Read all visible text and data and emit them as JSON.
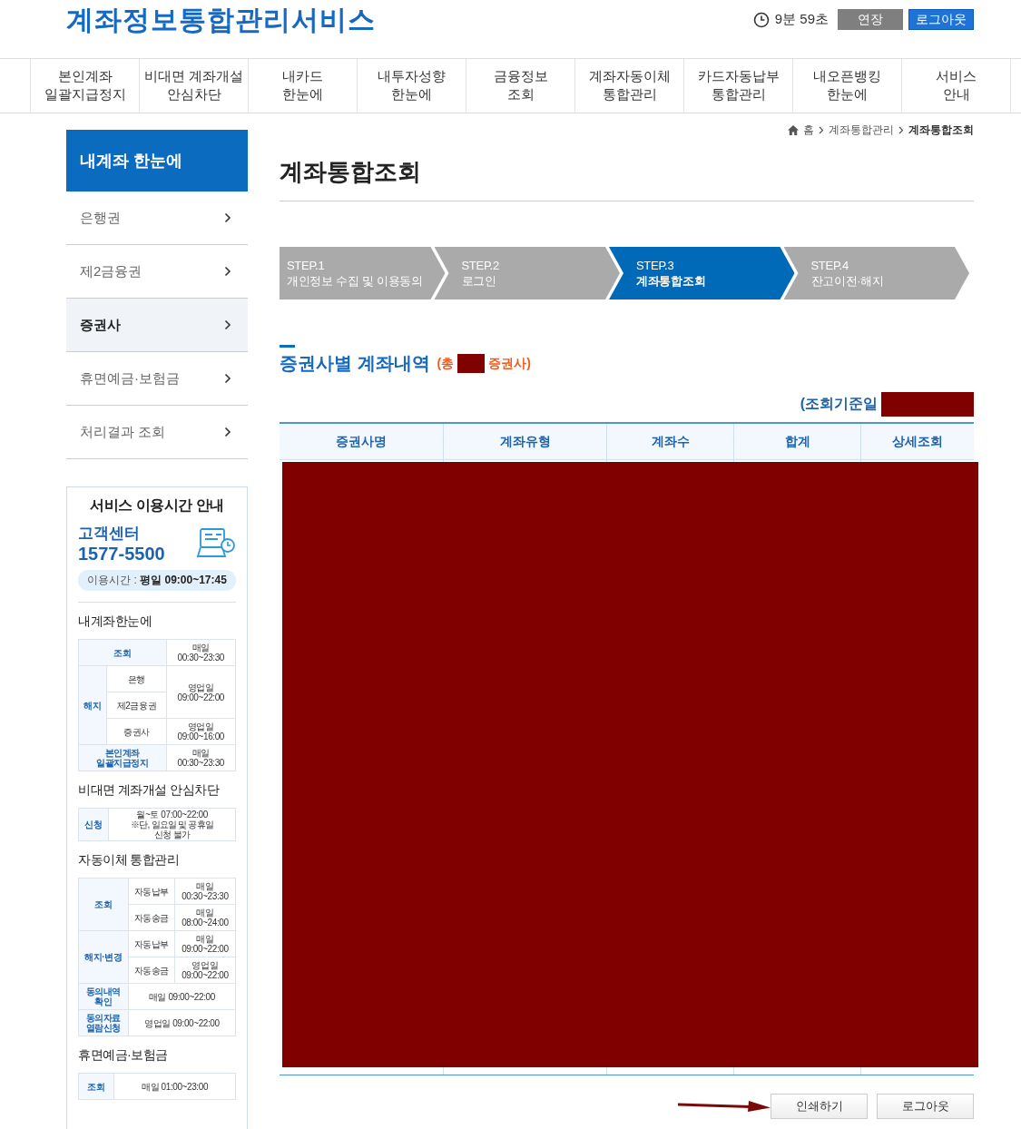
{
  "header": {
    "logo": "계좌정보통합관리서비스",
    "timer": "9분 59초",
    "buttons": [
      {
        "label": "연장",
        "kind": "extend"
      },
      {
        "label": "로그아웃",
        "kind": "logout"
      }
    ]
  },
  "nav": [
    {
      "label": "본인계좌\n일괄지급정지"
    },
    {
      "label": "비대면 계좌개설\n안심차단"
    },
    {
      "label": "내카드\n한눈에"
    },
    {
      "label": "내투자성향\n한눈에"
    },
    {
      "label": "금융정보\n조회"
    },
    {
      "label": "계좌자동이체\n통합관리"
    },
    {
      "label": "카드자동납부\n통합관리"
    },
    {
      "label": "내오픈뱅킹\n한눈에"
    },
    {
      "label": "서비스\n안내"
    }
  ],
  "sidebar": {
    "title": "내계좌 한눈에",
    "items": [
      {
        "label": "은행권",
        "selected": false
      },
      {
        "label": "제2금융권",
        "selected": false
      },
      {
        "label": "증권사",
        "selected": true
      },
      {
        "label": "휴면예금·보험금",
        "selected": false
      },
      {
        "label": "처리결과 조회",
        "selected": false
      }
    ]
  },
  "service_hours": {
    "title": "서비스 이용시간 안내",
    "center_label": "고객센터",
    "phone": "1577-5500",
    "hours": "이용시간 : **평일 09:00~17:45**",
    "sections": [
      {
        "title": "내계좌한눈에",
        "rows": [
          [
            {
              "text": "조회",
              "head": true,
              "colspan": 2
            },
            {
              "text": "매일\n00:30~23:30"
            }
          ],
          [
            {
              "text": "해지",
              "head": true,
              "rowspan": 3
            },
            {
              "text": "은행"
            },
            {
              "text": "영업일\n09:00~22:00",
              "rowspan": 2
            }
          ],
          [
            {
              "text": "제2금융권"
            }
          ],
          [
            {
              "text": "증권사"
            },
            {
              "text": "영업일\n09:00~16:00"
            }
          ],
          [
            {
              "text": "본인계좌\n일괄지급정지",
              "head": true,
              "colspan": 2
            },
            {
              "text": "매일\n00:30~23:30"
            }
          ]
        ]
      },
      {
        "title": "비대면 계좌개설 안심차단",
        "rows": [
          [
            {
              "text": "신청",
              "head": true
            },
            {
              "text": "월~토 07:00~22:00",
              "note": "※단, 일요일 및 공휴일\n신청 불가"
            }
          ]
        ]
      },
      {
        "title": "자동이체 통합관리",
        "rows": [
          [
            {
              "text": "조회",
              "head": true,
              "rowspan": 2
            },
            {
              "text": "자동납부"
            },
            {
              "text": "매일\n00:30~23:30"
            }
          ],
          [
            {
              "text": "자동송금"
            },
            {
              "text": "매일\n08:00~24:00"
            }
          ],
          [
            {
              "text": "해지·변경",
              "head": true,
              "rowspan": 2
            },
            {
              "text": "자동납부"
            },
            {
              "text": "매일\n09:00~22:00"
            }
          ],
          [
            {
              "text": "자동송금"
            },
            {
              "text": "영업일\n09:00~22:00"
            }
          ],
          [
            {
              "text": "동의내역\n확인",
              "head": true
            },
            {
              "text": "매일 09:00~22:00",
              "colspan": 2
            }
          ],
          [
            {
              "text": "동의자료\n열람신청",
              "head": true
            },
            {
              "text": "영업일 09:00~22:00",
              "colspan": 2
            }
          ]
        ]
      },
      {
        "title": "휴면예금·보험금",
        "rows": [
          [
            {
              "text": "조회",
              "head": true
            },
            {
              "text": "매일 01:00~23:00"
            }
          ]
        ]
      }
    ]
  },
  "breadcrumb": [
    "홈",
    "계좌통합관리",
    "계좌통합조회"
  ],
  "page_title": "계좌통합조회",
  "steps": [
    {
      "step": "STEP.1",
      "label": "개인정보 수집 및 이용동의",
      "selected": false
    },
    {
      "step": "STEP.2",
      "label": "로그인",
      "selected": false
    },
    {
      "step": "STEP.3",
      "label": "계좌통합조회",
      "selected": true
    },
    {
      "step": "STEP.4",
      "label": "잔고이전·해지",
      "selected": false
    }
  ],
  "section": {
    "title": "증권사별 계좌내역",
    "count_prefix": "(총",
    "count_suffix": "증권사)",
    "date_label": "(조회기준일"
  },
  "table": {
    "columns": [
      "증권사명",
      "계좌유형",
      "계좌수",
      "합계",
      "상세조회"
    ]
  },
  "buttons": [
    "인쇄하기",
    "로그아웃"
  ]
}
